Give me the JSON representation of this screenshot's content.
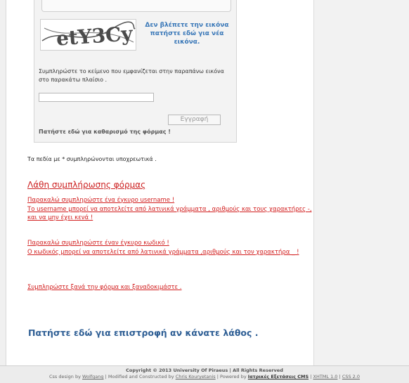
{
  "form": {
    "captcha_text": "etY3Cy",
    "refresh_link": "Δεν βλέπετε την εικόνα πατήστε εδώ για νέα εικόνα.",
    "instruction": "Συμπληρώστε το κείμενο που εμφανίζεται στην παραπάνω εικόνα στο παρακάτω πλαίσιο .",
    "captcha_input_value": "",
    "submit_label": "Εγγραφή",
    "reset_link": "Πατήστε εδώ για καθαρισμό της φόρμας !"
  },
  "required_note": "Τα πεδία με * συμπληρώνονται υποχρεωτικά .",
  "errors": {
    "heading": "Λάθη συμπλήρωσης φόρμας",
    "username_error": "Παρακαλώ συμπληρώστε ένα έγκυρο username !",
    "username_rule": "Το username μπορεί να αποτελείτε από λατινικά γράμματα , αριθμούς και τους χαρακτήρες -,   και να μην έχει κενά !",
    "password_error": "Παρακαλώ συμπληρώστε έναν έγκυρο κωδικό !",
    "password_rule": "Ο κωδικός μπορεί να αποτελείτε από λατινικά γράμματα ,αριθμούς και τον χαρακτήρα _ !",
    "retry": "Συμπληρώστε ξανά την φόρμα και ξαναδοκιμάστε ."
  },
  "back_link": "Πατήστε εδώ για επιστροφή αν κάνατε λάθος .",
  "footer": {
    "copyright": "Copyright © 2013 University Of Piraeus | All Rights Reserved",
    "css_design_prefix": "Css design by",
    "css_design_author": "Wolfgang",
    "modified_prefix": "| Modified and Constructed by",
    "modified_author": "Chris Kouryetanis",
    "powered_prefix": "| Powered by",
    "powered_link": "Ιατρικές Εξετάσεις CMS",
    "xhtml_link": "XHTML 1.0",
    "css_link": "CSS 2.0",
    "separator": "|"
  }
}
